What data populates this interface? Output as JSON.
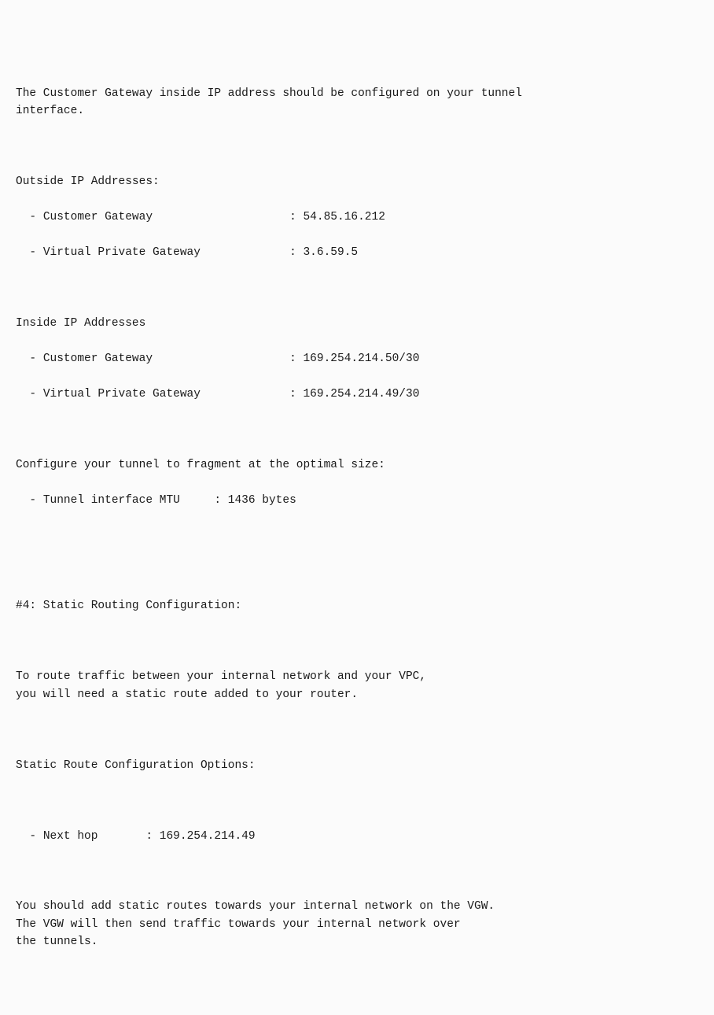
{
  "intro": "The Customer Gateway inside IP address should be configured on your tunnel\ninterface.",
  "outside": {
    "heading": "Outside IP Addresses:",
    "items": [
      {
        "label": "Customer Gateway",
        "value": "54.85.16.212"
      },
      {
        "label": "Virtual Private Gateway",
        "value": "3.6.59.5"
      }
    ]
  },
  "inside": {
    "heading": "Inside IP Addresses",
    "items": [
      {
        "label": "Customer Gateway",
        "value": "169.254.214.50/30"
      },
      {
        "label": "Virtual Private Gateway",
        "value": "169.254.214.49/30"
      }
    ]
  },
  "fragment": {
    "text": "Configure your tunnel to fragment at the optimal size:",
    "mtu": {
      "label": "Tunnel interface MTU",
      "value": "1436 bytes"
    }
  },
  "routing": {
    "heading": "#4: Static Routing Configuration:",
    "para1": "To route traffic between your internal network and your VPC,\nyou will need a static route added to your router.",
    "options_heading": "Static Route Configuration Options:",
    "next_hop": {
      "label": "Next hop",
      "value": "169.254.214.49"
    },
    "para2": "You should add static routes towards your internal network on the VGW.\nThe VGW will then send traffic towards your internal network over\nthe tunnels."
  }
}
